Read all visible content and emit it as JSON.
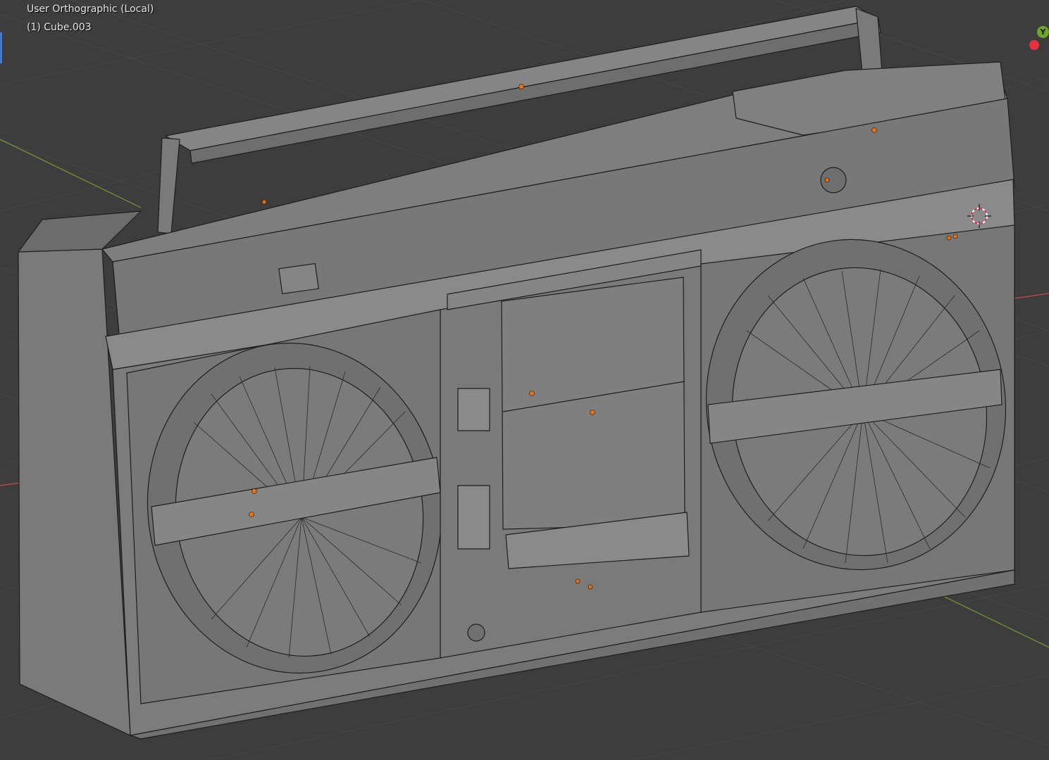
{
  "viewport": {
    "view_name": "User Orthographic (Local)",
    "object_name": "(1) Cube.003",
    "gizmo": {
      "y_label": "Y",
      "y_color": "#6ea627",
      "x_color": "#e8313e"
    },
    "colors": {
      "background": "#3d3d3d",
      "grid": "#474747",
      "mesh_face": "#7c7c7c",
      "mesh_face_dark": "#6a6a6a",
      "mesh_face_light": "#8a8a8a",
      "wire": "#1e1e1e",
      "origin_dot": "#e2721b",
      "axis_x": "#b2474d",
      "axis_y": "#6c8a3a"
    }
  }
}
